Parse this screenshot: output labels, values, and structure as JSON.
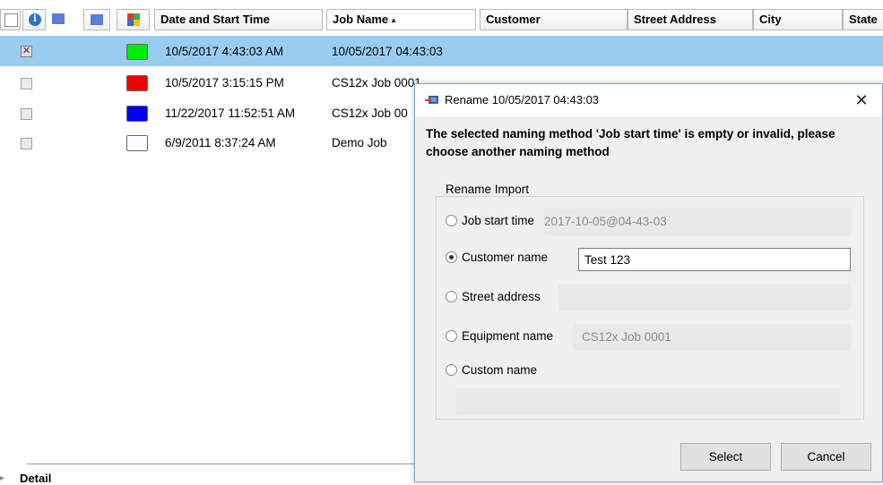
{
  "grid": {
    "headers": {
      "date_start": "Date and Start Time",
      "job_name": "Job Name",
      "customer": "Customer",
      "street_address": "Street Address",
      "city": "City",
      "state": "State"
    },
    "sort_indicator": "▲",
    "rows": [
      {
        "checked": true,
        "color": "#00ee00",
        "date": "10/5/2017 4:43:03 AM",
        "job": "10/05/2017 04:43:03",
        "selected": true
      },
      {
        "checked": false,
        "color": "#ee0000",
        "date": "10/5/2017 3:15:15 PM",
        "job": "CS12x Job 0001",
        "selected": false
      },
      {
        "checked": false,
        "color": "#0000ee",
        "date": "11/22/2017 11:52:51 AM",
        "job": "CS12x Job 00",
        "selected": false
      },
      {
        "checked": false,
        "color": "#ffffff",
        "date": "6/9/2011 8:37:24 AM",
        "job": "Demo Job",
        "selected": false
      }
    ],
    "details_label": "Detail",
    "colors": {
      "selection": "#99cdf0"
    }
  },
  "dialog": {
    "title": "Rename 10/05/2017 04:43:03",
    "close_symbol": "✕",
    "message": "The selected naming method 'Job start time' is empty or invalid, please choose another naming method",
    "group_label": "Rename Import",
    "options": {
      "job_start_time": {
        "label": "Job start time",
        "value": "2017-10-05@04-43-03",
        "selected": false
      },
      "customer_name": {
        "label": "Customer name",
        "value": "Test 123",
        "selected": true
      },
      "street_address": {
        "label": "Street address",
        "value": "",
        "selected": false
      },
      "equipment_name": {
        "label": "Equipment name",
        "value": "CS12x Job 0001",
        "selected": false
      },
      "custom_name": {
        "label": "Custom name",
        "value": "",
        "selected": false
      }
    },
    "buttons": {
      "select": "Select",
      "cancel": "Cancel"
    }
  }
}
